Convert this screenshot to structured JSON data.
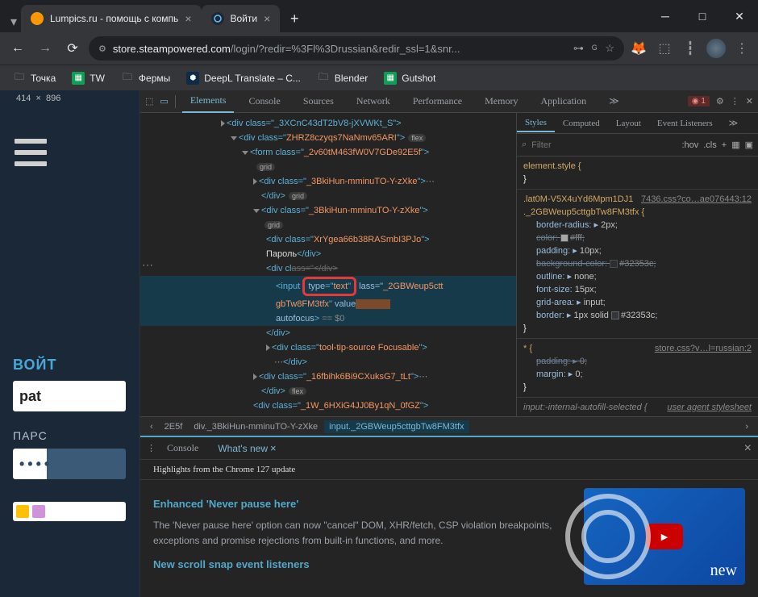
{
  "tabs": [
    {
      "title": "Lumpics.ru - помощь с компь",
      "favicon_color": "#ff9800"
    },
    {
      "title": "Войти",
      "favicon_color": "#1b2838"
    }
  ],
  "url": {
    "domain": "store.steampowered.com",
    "path": "/login/?redir=%3Fl%3Drussian&redir_ssl=1&snr..."
  },
  "bookmarks": [
    {
      "label": "Точка",
      "icon": "folder"
    },
    {
      "label": "TW",
      "icon": "sheets"
    },
    {
      "label": "Фермы",
      "icon": "folder"
    },
    {
      "label": "DeepL Translate – С...",
      "icon": "deepl"
    },
    {
      "label": "Blender",
      "icon": "folder"
    },
    {
      "label": "Gutshot",
      "icon": "sheets"
    }
  ],
  "viewport": {
    "width": "414",
    "height": "896"
  },
  "page": {
    "login": "ВОЙТ",
    "input_value": "pat",
    "password_label": "ПАРС",
    "dots": "••••"
  },
  "devtools": {
    "tabs": [
      "Elements",
      "Console",
      "Sources",
      "Network",
      "Performance",
      "Memory",
      "Application"
    ],
    "active_tab": "Elements",
    "error_count": "1",
    "styles_tabs": [
      "Styles",
      "Computed",
      "Layout",
      "Event Listeners"
    ],
    "filter_placeholder": "Filter",
    "hov": ":hov",
    "cls": ".cls",
    "breadcrumb": [
      "...",
      "2E5f",
      "div._3BkiHun-mminuTO-Y-zXke",
      "input._2GBWeup5cttgbTw8FM3tfx"
    ],
    "dom": {
      "l1": "<div class=\"_3XCnC43dT2bV8-jXVWKt_S\">",
      "l2": "<div class=\"ZHRZ8czyqs7NaNmv65ARI\">",
      "l3": "<form class=\"_2v60tM463fW0V7GDe92E5f\">",
      "l4": "<div class=\"_3BkiHun-mminuTO-Y-zXke\">",
      "l4c": "</div>",
      "l5": "<div class=\"_3BkiHun-mminuTO-Y-zXke\">",
      "l6": "<div class=\"XrYgea66b38RASmbI3PJo\">",
      "l6t": "Пароль",
      "l6c": "</div>",
      "l7a": "<div cl",
      "l7b": "ass=\"...\">",
      "input_open": "<input",
      "input_type": "type=\"text\"",
      "input_rest": "lass=\"_2GBWeup5ctt",
      "input_line2": "gbTw8FM3tfx\" value",
      "autofocus": "autofocus>",
      "eq": " == $0",
      "divclose": "</div>",
      "l8": "<div class=\"tool-tip-source Focusable\">",
      "l8c": "</div>",
      "l9": "<div class=\"_16fbihk6Bi9CXuksG7_tLt\">",
      "l9c": "</div>",
      "l10": "<div class=\"_1W_6HXiG4JJ0By1qN_0fGZ\">"
    },
    "styles": {
      "element_style": "element.style {",
      "r1_sel": ".lat0M-V5X4uYd6Mpm1DJ1 ._2GBWeup5cttgbTw8FM3tfx {",
      "r1_src": "7436.css?co…ae076443:12",
      "p1": "border-radius",
      "v1": "2px",
      "p2": "color",
      "v2": "#fff",
      "p3": "padding",
      "v3": "10px",
      "p4": "background-color",
      "v4": "#32353c",
      "p5": "outline",
      "v5": "none",
      "p6": "font-size",
      "v6": "15px",
      "p7": "grid-area",
      "v7": "input",
      "p8": "border",
      "v8": "1px solid",
      "v8b": "#32353c",
      "r2_sel": "* {",
      "r2_src": "store.css?v…l=russian:2",
      "p9": "padding",
      "v9": "0",
      "p10": "margin",
      "v10": "0",
      "r3": "input:-internal-autofill-selected {",
      "r3_src": "user agent stylesheet"
    },
    "drawer": {
      "tabs": [
        "Console",
        "What's new"
      ],
      "highlights": "Highlights from the Chrome 127 update",
      "h1": "Enhanced 'Never pause here'",
      "p1": "The 'Never pause here' option can now \"cancel\" DOM, XHR/fetch, CSP violation breakpoints, exceptions and promise rejections from built-in functions, and more.",
      "h2": "New scroll snap event listeners",
      "thumb_text": "new"
    }
  }
}
